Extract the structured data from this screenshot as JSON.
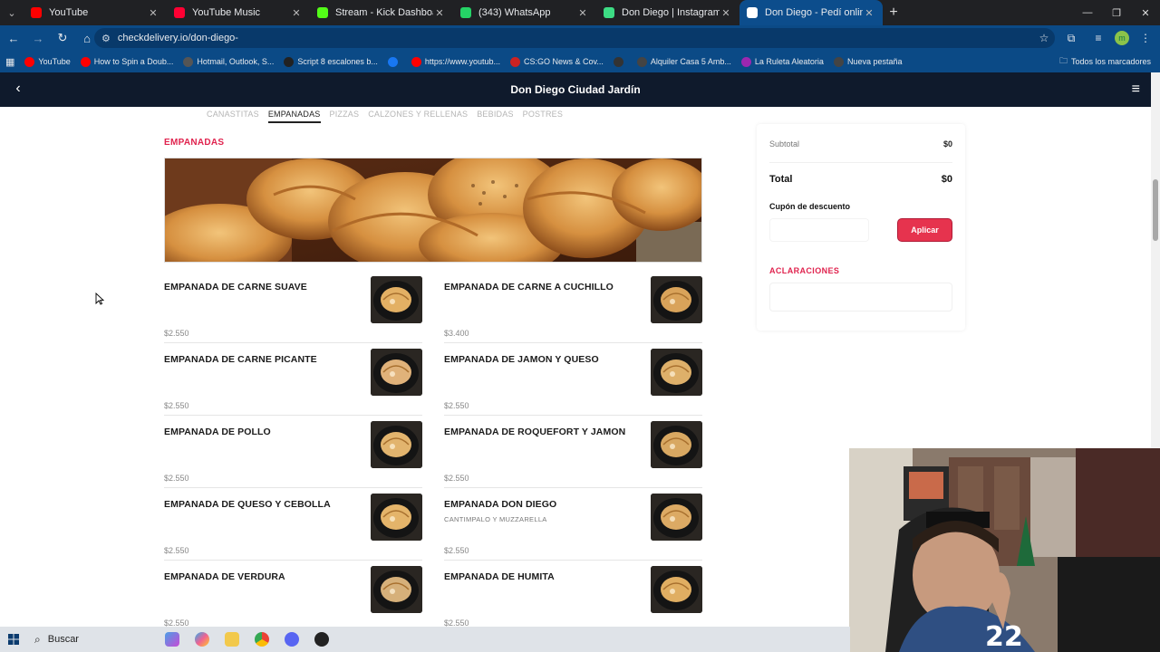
{
  "browser": {
    "tabs": [
      {
        "title": "YouTube",
        "color": "#ff0000",
        "active": false
      },
      {
        "title": "YouTube Music",
        "color": "#ff0033",
        "active": false
      },
      {
        "title": "Stream - Kick Dashboard",
        "color": "#53fc18",
        "active": false
      },
      {
        "title": "(343) WhatsApp",
        "color": "#25d366",
        "active": false
      },
      {
        "title": "Don Diego | Instagram, Facebook",
        "color": "#3ddc84",
        "active": false
      },
      {
        "title": "Don Diego - Pedí online, Delive",
        "color": "#ffffff",
        "active": true
      }
    ],
    "url": "checkdelivery.io/don-diego-",
    "bookmarks": [
      {
        "label": "YouTube",
        "color": "#ff0000"
      },
      {
        "label": "How to Spin a Doub...",
        "color": "#ff0000"
      },
      {
        "label": "Hotmail, Outlook, S...",
        "color": "#555555"
      },
      {
        "label": "Script 8 escalones b...",
        "color": "#222222"
      },
      {
        "label": "",
        "color": "#1877f2"
      },
      {
        "label": "https://www.youtub...",
        "color": "#ff0000"
      },
      {
        "label": "CS:GO News & Cov...",
        "color": "#cc2222"
      },
      {
        "label": "",
        "color": "#333333"
      },
      {
        "label": "Alquiler Casa 5 Amb...",
        "color": "#444444"
      },
      {
        "label": "La Ruleta Aleatoria",
        "color": "#9c27b0"
      },
      {
        "label": "Nueva pestaña",
        "color": "#444444"
      }
    ],
    "bookmarks_folder": "Todos los marcadores"
  },
  "header": {
    "title": "Don Diego Ciudad Jardín"
  },
  "categories": [
    "CANASTITAS",
    "EMPANADAS",
    "PIZZAS",
    "CALZONES Y RELLENAS",
    "BEBIDAS",
    "POSTRES"
  ],
  "section": {
    "title": "EMPANADAS"
  },
  "products": [
    {
      "name": "EMPANADA DE CARNE SUAVE",
      "desc": "",
      "price": "$2.550"
    },
    {
      "name": "EMPANADA DE CARNE A CUCHILLO",
      "desc": "",
      "price": "$3.400"
    },
    {
      "name": "EMPANADA DE CARNE PICANTE",
      "desc": "",
      "price": "$2.550"
    },
    {
      "name": "EMPANADA DE JAMON Y QUESO",
      "desc": "",
      "price": "$2.550"
    },
    {
      "name": "EMPANADA DE POLLO",
      "desc": "",
      "price": "$2.550"
    },
    {
      "name": "EMPANADA DE ROQUEFORT Y JAMON",
      "desc": "",
      "price": "$2.550"
    },
    {
      "name": "EMPANADA DE QUESO Y CEBOLLA",
      "desc": "",
      "price": "$2.550"
    },
    {
      "name": "EMPANADA DON DIEGO",
      "desc": "CANTIMPALO Y MUZZARELLA",
      "price": "$2.550"
    },
    {
      "name": "EMPANADA DE VERDURA",
      "desc": "",
      "price": "$2.550"
    },
    {
      "name": "EMPANADA DE HUMITA",
      "desc": "",
      "price": "$2.550"
    }
  ],
  "cart": {
    "subtotal_label": "Subtotal",
    "subtotal_value": "$0",
    "total_label": "Total",
    "total_value": "$0",
    "coupon_label": "Cupón de descuento",
    "coupon_value": "",
    "apply_label": "Aplicar",
    "notes_label": "ACLARACIONES",
    "notes_value": ""
  },
  "taskbar": {
    "search_placeholder": "Buscar"
  },
  "colors": {
    "accent": "#e0234e",
    "header_bg": "#0f1a2c",
    "browser_chrome": "#0b4a86"
  }
}
